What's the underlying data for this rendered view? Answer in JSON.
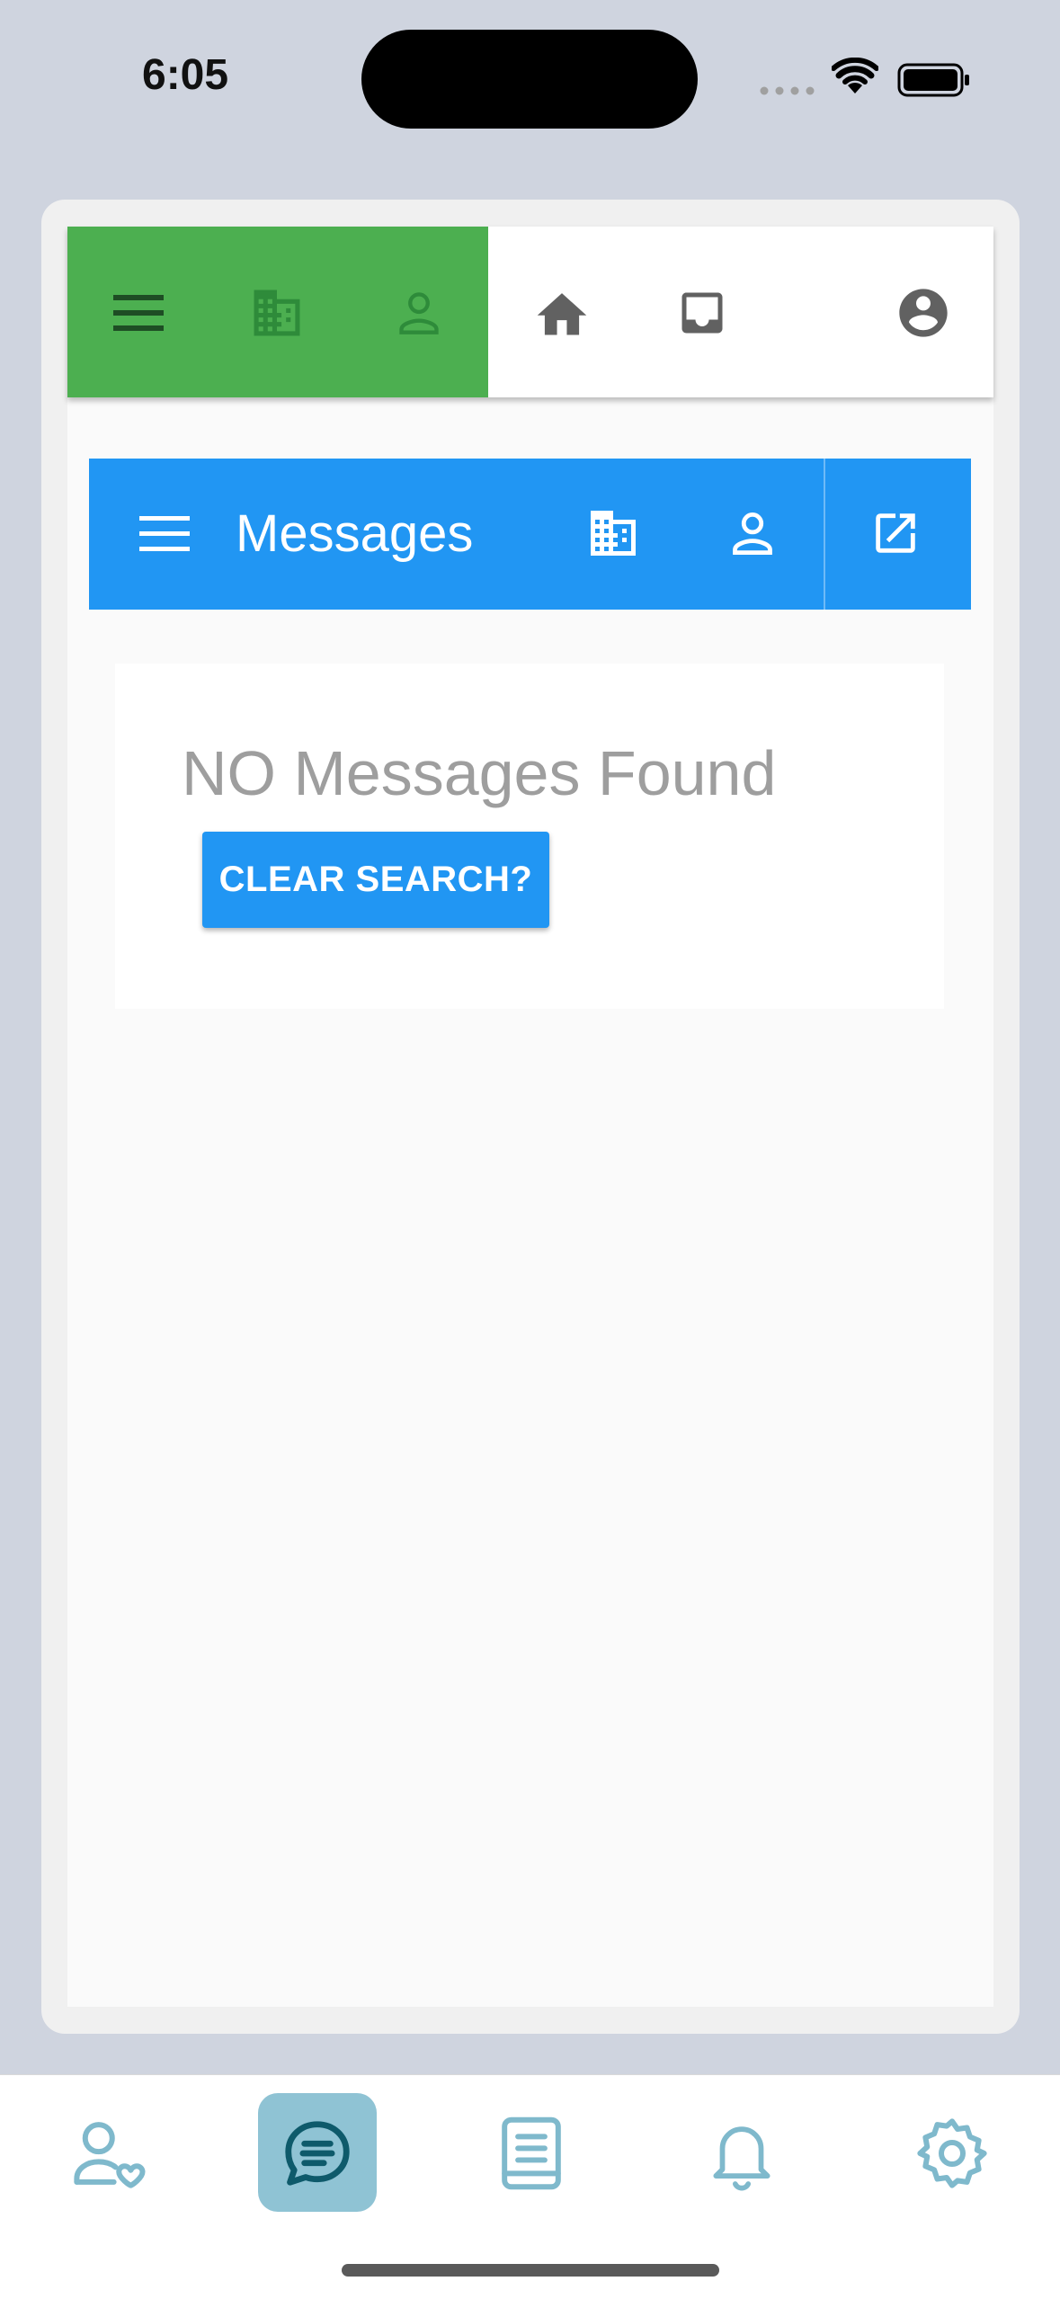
{
  "status_bar": {
    "time": "6:05"
  },
  "top_bar": {
    "icons": [
      "menu-icon",
      "business-icon",
      "person-icon",
      "home-icon",
      "inbox-icon",
      "account-circle-icon"
    ],
    "green_color": "#4caf50"
  },
  "messages_bar": {
    "title": "Messages",
    "color": "#2196f3",
    "icons": [
      "menu-icon",
      "business-icon",
      "person-icon",
      "open-in-new-icon"
    ]
  },
  "empty_state": {
    "message": "NO Messages Found",
    "button_label": "CLEAR SEARCH?"
  },
  "tab_bar": {
    "tabs": [
      "contacts-icon",
      "chat-icon",
      "book-icon",
      "bell-icon",
      "settings-icon"
    ],
    "active_index": 1,
    "accent": "#7fb9cc"
  }
}
